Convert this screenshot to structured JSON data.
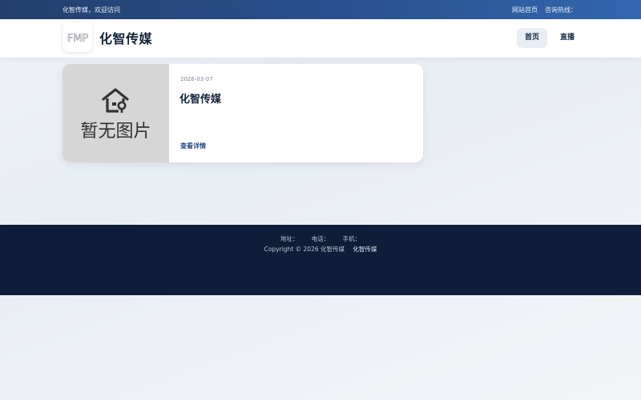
{
  "topbar": {
    "welcome": "化智传媒，欢迎访问",
    "home_link": "网站首页",
    "hotline": "咨询热线："
  },
  "header": {
    "logo_text": "FMP",
    "site_name": "化智传媒",
    "nav": [
      {
        "label": "首页",
        "active": true
      },
      {
        "label": "直播",
        "active": false
      }
    ]
  },
  "card": {
    "placeholder_text": "暂无图片",
    "date": "2026-03-07",
    "title": "化智传媒",
    "more": "查看详情"
  },
  "footer": {
    "address": "地址：",
    "phone": "电话：",
    "mobile": "手机：",
    "copyright": "Copyright © 2026 化智传媒",
    "brand": "化智传媒"
  },
  "colors": {
    "topbar": "#2a5391",
    "footer": "#0f1e38",
    "accent": "#2a4f86"
  }
}
